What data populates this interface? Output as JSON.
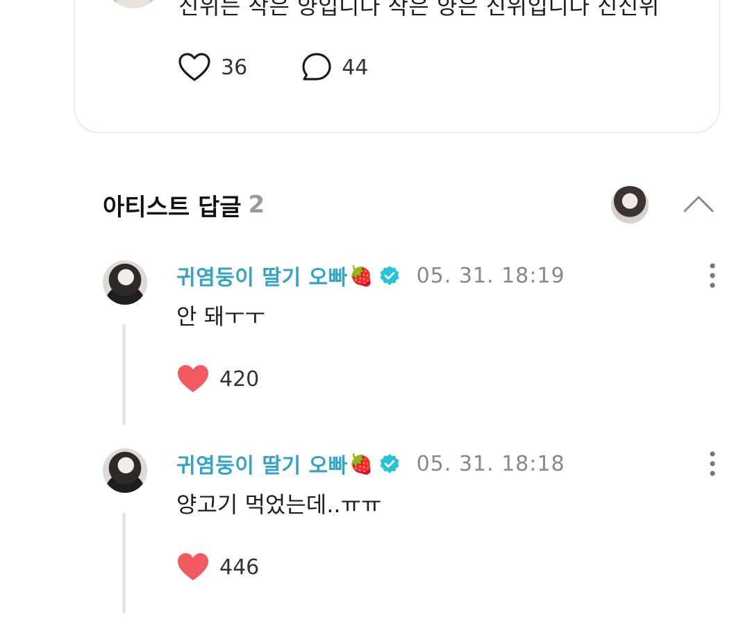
{
  "post": {
    "text": "신위는 작은 양입니다 작은 양은 신위입니다 신신위",
    "like_count": "36",
    "comment_count": "44"
  },
  "artist_replies": {
    "title": "아티스트 답글",
    "count": "2"
  },
  "comments": [
    {
      "author": "귀염둥이 딸기 오빠",
      "emoji": "🍓",
      "timestamp": "05. 31. 18:19",
      "text": "안 돼ㅜㅜ",
      "likes": "420"
    },
    {
      "author": "귀염둥이 딸기 오빠",
      "emoji": "🍓",
      "timestamp": "05. 31. 18:18",
      "text": "양고기 먹었는데..ㅠㅠ",
      "likes": "446"
    }
  ],
  "icons": {
    "like_outline": "heart-outline-icon",
    "comment": "speech-bubble-icon",
    "like_filled": "heart-filled-icon",
    "verified": "verified-badge-icon",
    "more": "more-vertical-icon",
    "collapse": "chevron-up-icon"
  },
  "colors": {
    "author": "#33a4c4",
    "heart": "#f25a5f",
    "verified": "#27c3d9",
    "muted": "#888888"
  }
}
